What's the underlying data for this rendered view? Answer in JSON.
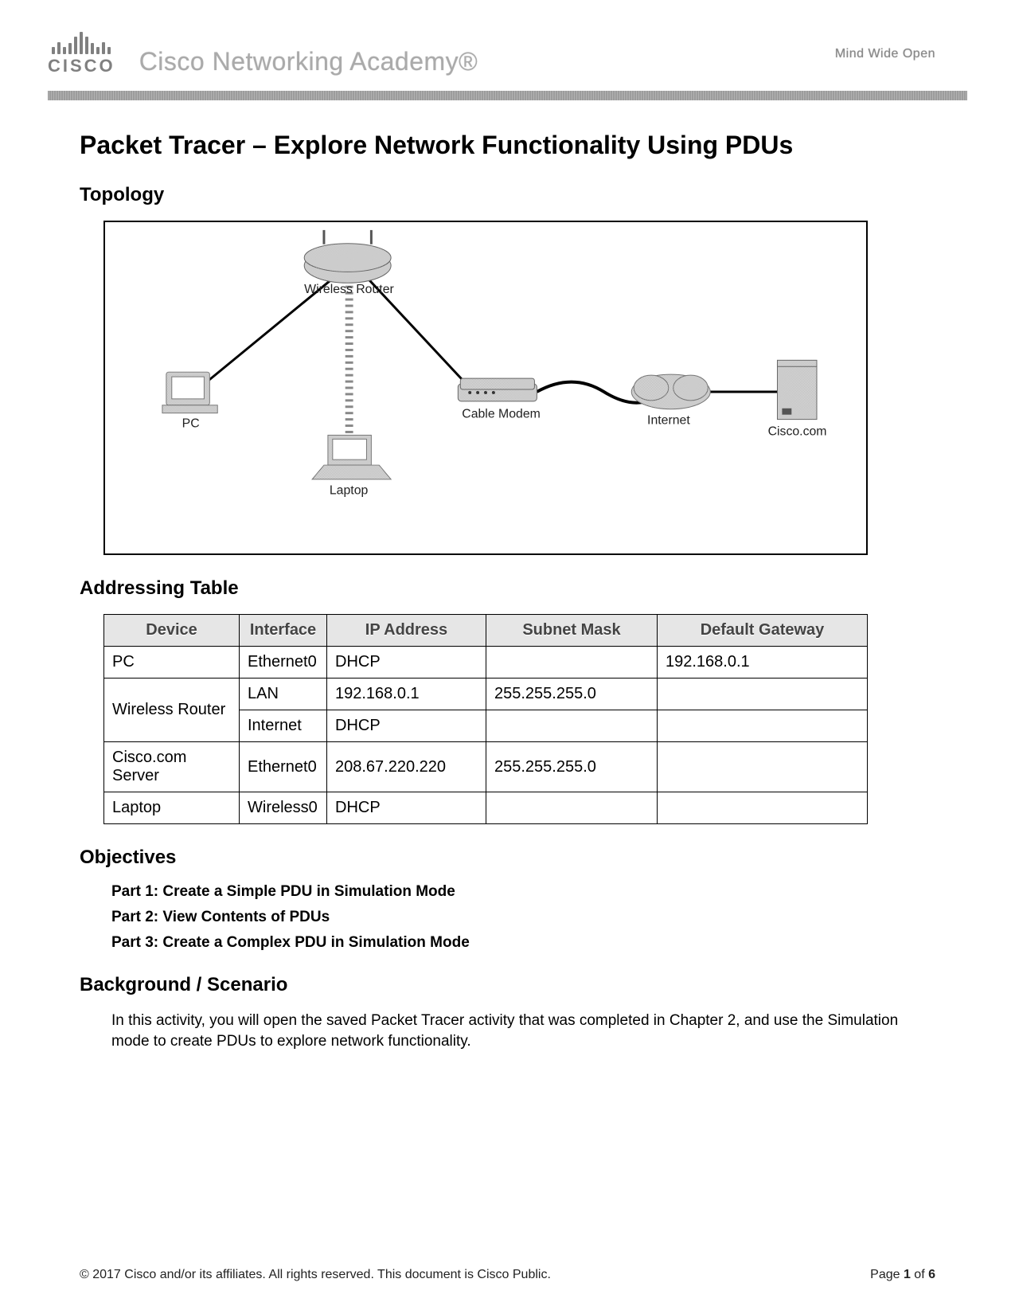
{
  "header": {
    "logo_word": "CISCO",
    "academy": "Cisco Networking Academy®",
    "tagline": "Mind Wide Open"
  },
  "title": "Packet Tracer – Explore Network Functionality Using PDUs",
  "sections": {
    "topology": "Topology",
    "addressing": "Addressing Table",
    "objectives": "Objectives",
    "background": "Background / Scenario"
  },
  "topology": {
    "devices": {
      "router": "Wireless Router",
      "pc": "PC",
      "laptop": "Laptop",
      "modem": "Cable Modem",
      "internet": "Internet",
      "server": "Cisco.com"
    }
  },
  "table": {
    "headers": [
      "Device",
      "Interface",
      "IP Address",
      "Subnet Mask",
      "Default Gateway"
    ],
    "rows": [
      {
        "device": "PC",
        "iface": "Ethernet0",
        "ip": "DHCP",
        "mask": "",
        "gw": "192.168.0.1"
      },
      {
        "device": "Wireless Router",
        "iface": "LAN",
        "ip": "192.168.0.1",
        "mask": "255.255.255.0",
        "gw": ""
      },
      {
        "device": "",
        "iface": "Internet",
        "ip": "DHCP",
        "mask": "",
        "gw": ""
      },
      {
        "device": "Cisco.com Server",
        "iface": "Ethernet0",
        "ip": "208.67.220.220",
        "mask": "255.255.255.0",
        "gw": ""
      },
      {
        "device": "Laptop",
        "iface": "Wireless0",
        "ip": "DHCP",
        "mask": "",
        "gw": ""
      }
    ]
  },
  "objectives": [
    "Part 1: Create a Simple PDU in Simulation Mode",
    "Part 2: View Contents of PDUs",
    "Part 3: Create a Complex PDU in Simulation Mode"
  ],
  "background_text": "In this activity, you will open the saved Packet Tracer activity that was completed in Chapter 2, and use the Simulation mode to create PDUs to explore network functionality.",
  "footer": {
    "copyright": "© 2017 Cisco and/or its affiliates. All rights reserved. This document is Cisco Public.",
    "page_prefix": "Page ",
    "page_num": "1",
    "page_of": " of ",
    "page_total": "6"
  },
  "chart_data": {
    "type": "table",
    "title": "Addressing Table",
    "columns": [
      "Device",
      "Interface",
      "IP Address",
      "Subnet Mask",
      "Default Gateway"
    ],
    "rows": [
      [
        "PC",
        "Ethernet0",
        "DHCP",
        "",
        "192.168.0.1"
      ],
      [
        "Wireless Router",
        "LAN",
        "192.168.0.1",
        "255.255.255.0",
        ""
      ],
      [
        "Wireless Router",
        "Internet",
        "DHCP",
        "",
        ""
      ],
      [
        "Cisco.com Server",
        "Ethernet0",
        "208.67.220.220",
        "255.255.255.0",
        ""
      ],
      [
        "Laptop",
        "Wireless0",
        "DHCP",
        "",
        ""
      ]
    ]
  }
}
